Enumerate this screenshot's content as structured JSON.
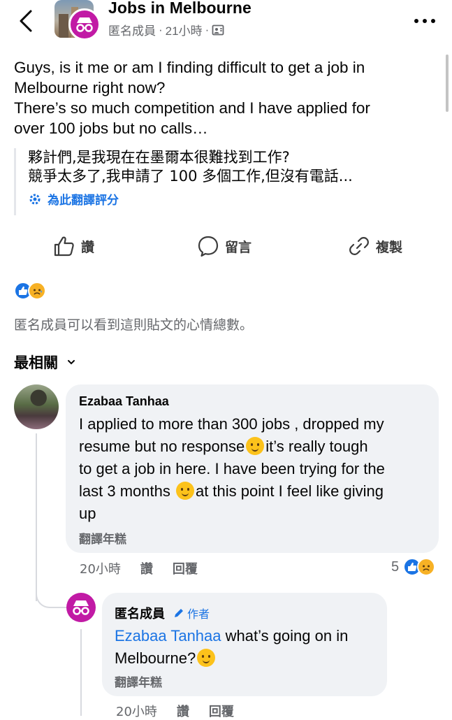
{
  "header": {
    "group_name": "Jobs in Melbourne",
    "author_name": "匿名成員",
    "separator": "·",
    "time": "21小時",
    "privacy_icon": "members-only-icon"
  },
  "post": {
    "lines": [
      "Guys, is it me or am I finding difficult to get a job in",
      "Melbourne right now?",
      "There’s so much competition and I have applied for",
      "over 100 jobs but no calls…"
    ],
    "translation_lines": [
      "夥計們,是我現在在墨爾本很難找到工作?",
      "競爭太多了,我申請了 100 多個工作,但沒有電話..."
    ],
    "rate_translation": "為此翻譯評分"
  },
  "actions": {
    "like": "讚",
    "comment": "留言",
    "copy": "複製"
  },
  "reactions": {
    "icons": [
      "like-reaction-icon",
      "sad-reaction-icon"
    ],
    "note": "匿名成員可以看到這則貼文的心情總數。"
  },
  "sort": {
    "label": "最相關"
  },
  "comments": [
    {
      "author": "Ezabaa Tanhaa",
      "lines": [
        [
          "I applied to more than 300 jobs , dropped my"
        ],
        [
          "resume but no response",
          "it’s really tough"
        ],
        [
          "to get a job in here. I have been trying for the"
        ],
        [
          "last 3 months ",
          "at this point I feel like giving"
        ],
        [
          "up"
        ]
      ],
      "translate": "翻譯年糕",
      "time": "20小時",
      "like": "讚",
      "reply": "回覆",
      "reaction_count": "5"
    },
    {
      "author": "匿名成員",
      "badge": "作者",
      "mention": "Ezabaa Tanhaa",
      "text_after_mention": " what’s going on in",
      "text_line2": "Melbourne?",
      "translate": "翻譯年糕",
      "time": "20小時",
      "like": "讚",
      "reply": "回覆"
    }
  ],
  "colors": {
    "accent": "#1b74e4",
    "anon_avatar": "#c11aa5",
    "bubble": "#f0f2f5",
    "secondary_text": "#65676b"
  }
}
